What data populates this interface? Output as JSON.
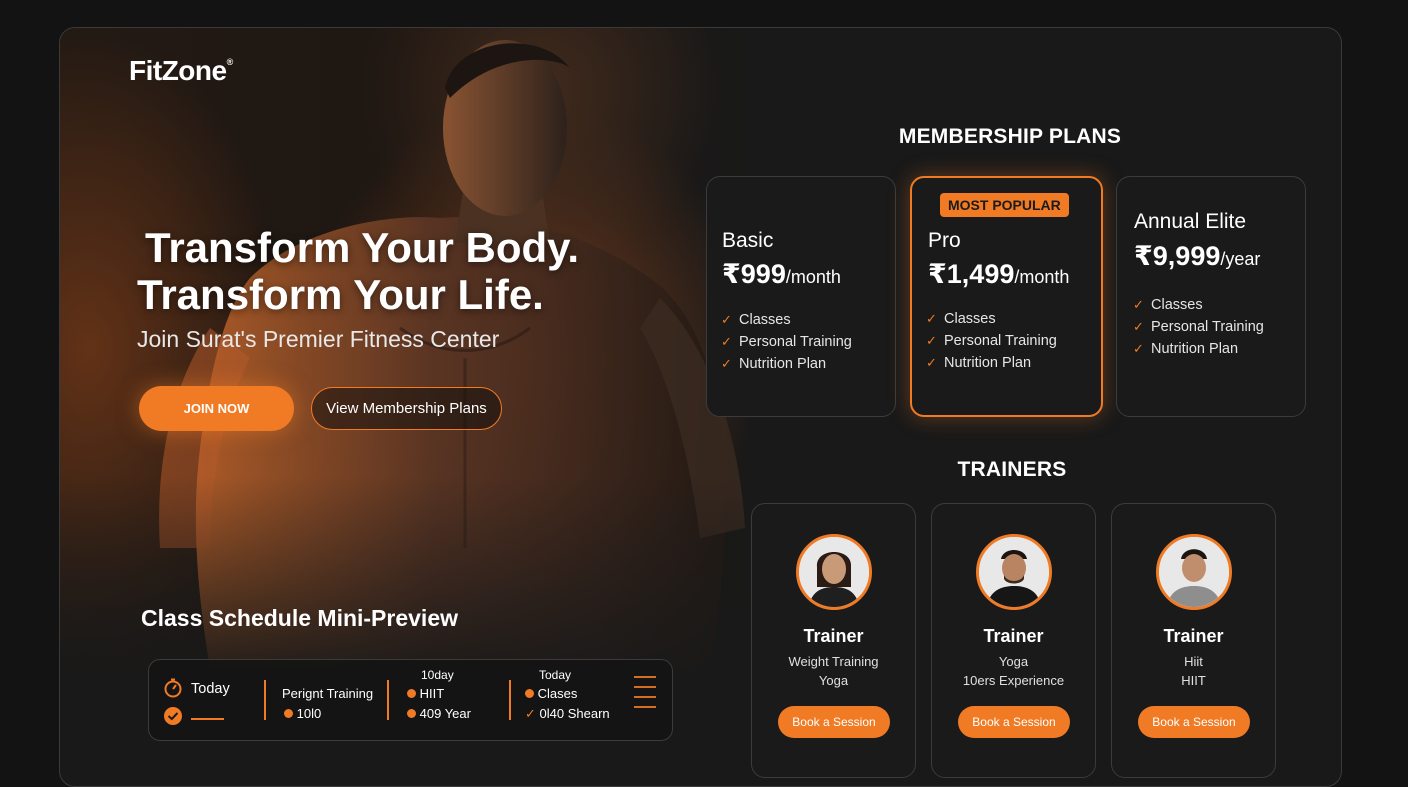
{
  "brand": {
    "logo": "FitZone",
    "logo_mark": "®"
  },
  "hero": {
    "headline_line1": "Transform Your Body.",
    "headline_line2": "Transform Your Life.",
    "subheadline": "Join Surat's Premier Fitness Center",
    "join_label": "JOIN NOW",
    "view_plans_label": "View Membership Plans"
  },
  "schedule": {
    "title": "Class Schedule Mini-Preview",
    "today_label": "Today",
    "col1": {
      "title": "Perignt Training",
      "item": "10l0"
    },
    "col2": {
      "header": "10day",
      "item1": "HIIT",
      "item2": "409 Year"
    },
    "col3": {
      "header": "Today",
      "item1": "Clases",
      "item2": "0l40 Shearn"
    }
  },
  "membership": {
    "title": "MEMBERSHIP PLANS",
    "plans": [
      {
        "name": "Basic",
        "price": "₹999",
        "period": "/month",
        "features": [
          "Classes",
          "Personal Training",
          "Nutrition Plan"
        ]
      },
      {
        "badge": "MOST POPULAR",
        "name": "Pro",
        "price": "₹1,499",
        "period": "/month",
        "features": [
          "Classes",
          "Personal Training",
          "Nutrition Plan"
        ]
      },
      {
        "name": "Annual Elite",
        "price": "₹9,999",
        "period": "/year",
        "features": [
          "Classes",
          "Personal Training",
          "Nutrition Plan"
        ]
      }
    ]
  },
  "trainers": {
    "title": "TRAINERS",
    "items": [
      {
        "name": "Trainer",
        "line1": "Weight Training",
        "line2": "Yoga",
        "cta": "Book a Session"
      },
      {
        "name": "Trainer",
        "line1": "Yoga",
        "line2": "10ers Experience",
        "cta": "Book a Session"
      },
      {
        "name": "Trainer",
        "line1": "Hiit",
        "line2": "HIIT",
        "cta": "Book a Session"
      }
    ]
  },
  "colors": {
    "accent": "#f07b24",
    "background": "#131313",
    "card": "#1a1a1a"
  }
}
